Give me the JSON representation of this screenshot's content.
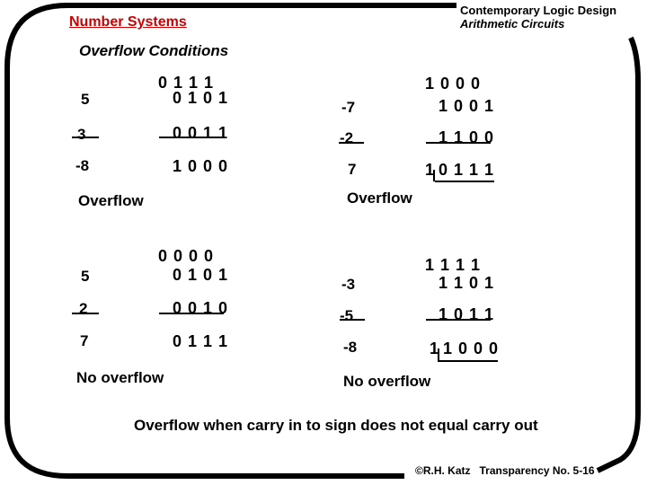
{
  "header": {
    "section_title": "Number Systems",
    "course_title": "Contemporary Logic Design",
    "chapter_title": "Arithmetic Circuits"
  },
  "slide": {
    "subtitle": "Overflow Conditions"
  },
  "examples": [
    {
      "carries": "0 1 1 1",
      "operand_a": {
        "decimal": "5",
        "binary": "0 1 0 1"
      },
      "operand_b": {
        "decimal": "3",
        "binary": "0 0 1 1"
      },
      "result": {
        "decimal": "-8",
        "binary": "1 0 0 0"
      },
      "verdict": "Overflow"
    },
    {
      "carries": "1 0 0 0",
      "operand_a": {
        "decimal": "-7",
        "binary": "1 0 0 1"
      },
      "operand_b": {
        "decimal": "-2",
        "binary": "1 1 0 0"
      },
      "result": {
        "decimal": "7",
        "carry_out": "1",
        "binary": "0 1 1 1"
      },
      "verdict": "Overflow"
    },
    {
      "carries": "0 0 0 0",
      "operand_a": {
        "decimal": "5",
        "binary": "0 1 0 1"
      },
      "operand_b": {
        "decimal": "2",
        "binary": "0 0 1 0"
      },
      "result": {
        "decimal": "7",
        "binary": "0 1 1 1"
      },
      "verdict": "No overflow"
    },
    {
      "carries": "1 1 1 1",
      "operand_a": {
        "decimal": "-3",
        "binary": "1 1 0 1"
      },
      "operand_b": {
        "decimal": "-5",
        "binary": "1 0 1 1"
      },
      "result": {
        "decimal": "-8",
        "carry_out": "1",
        "binary": "1 0 0 0"
      },
      "verdict": "No overflow"
    }
  ],
  "rule": "Overflow when carry in to sign does not equal carry out",
  "footer": {
    "credit": "©R.H. Katz   Transparency No. 5-16"
  },
  "colors": {
    "section_title": "#cc0000",
    "text": "#000000",
    "frame": "#000000"
  }
}
